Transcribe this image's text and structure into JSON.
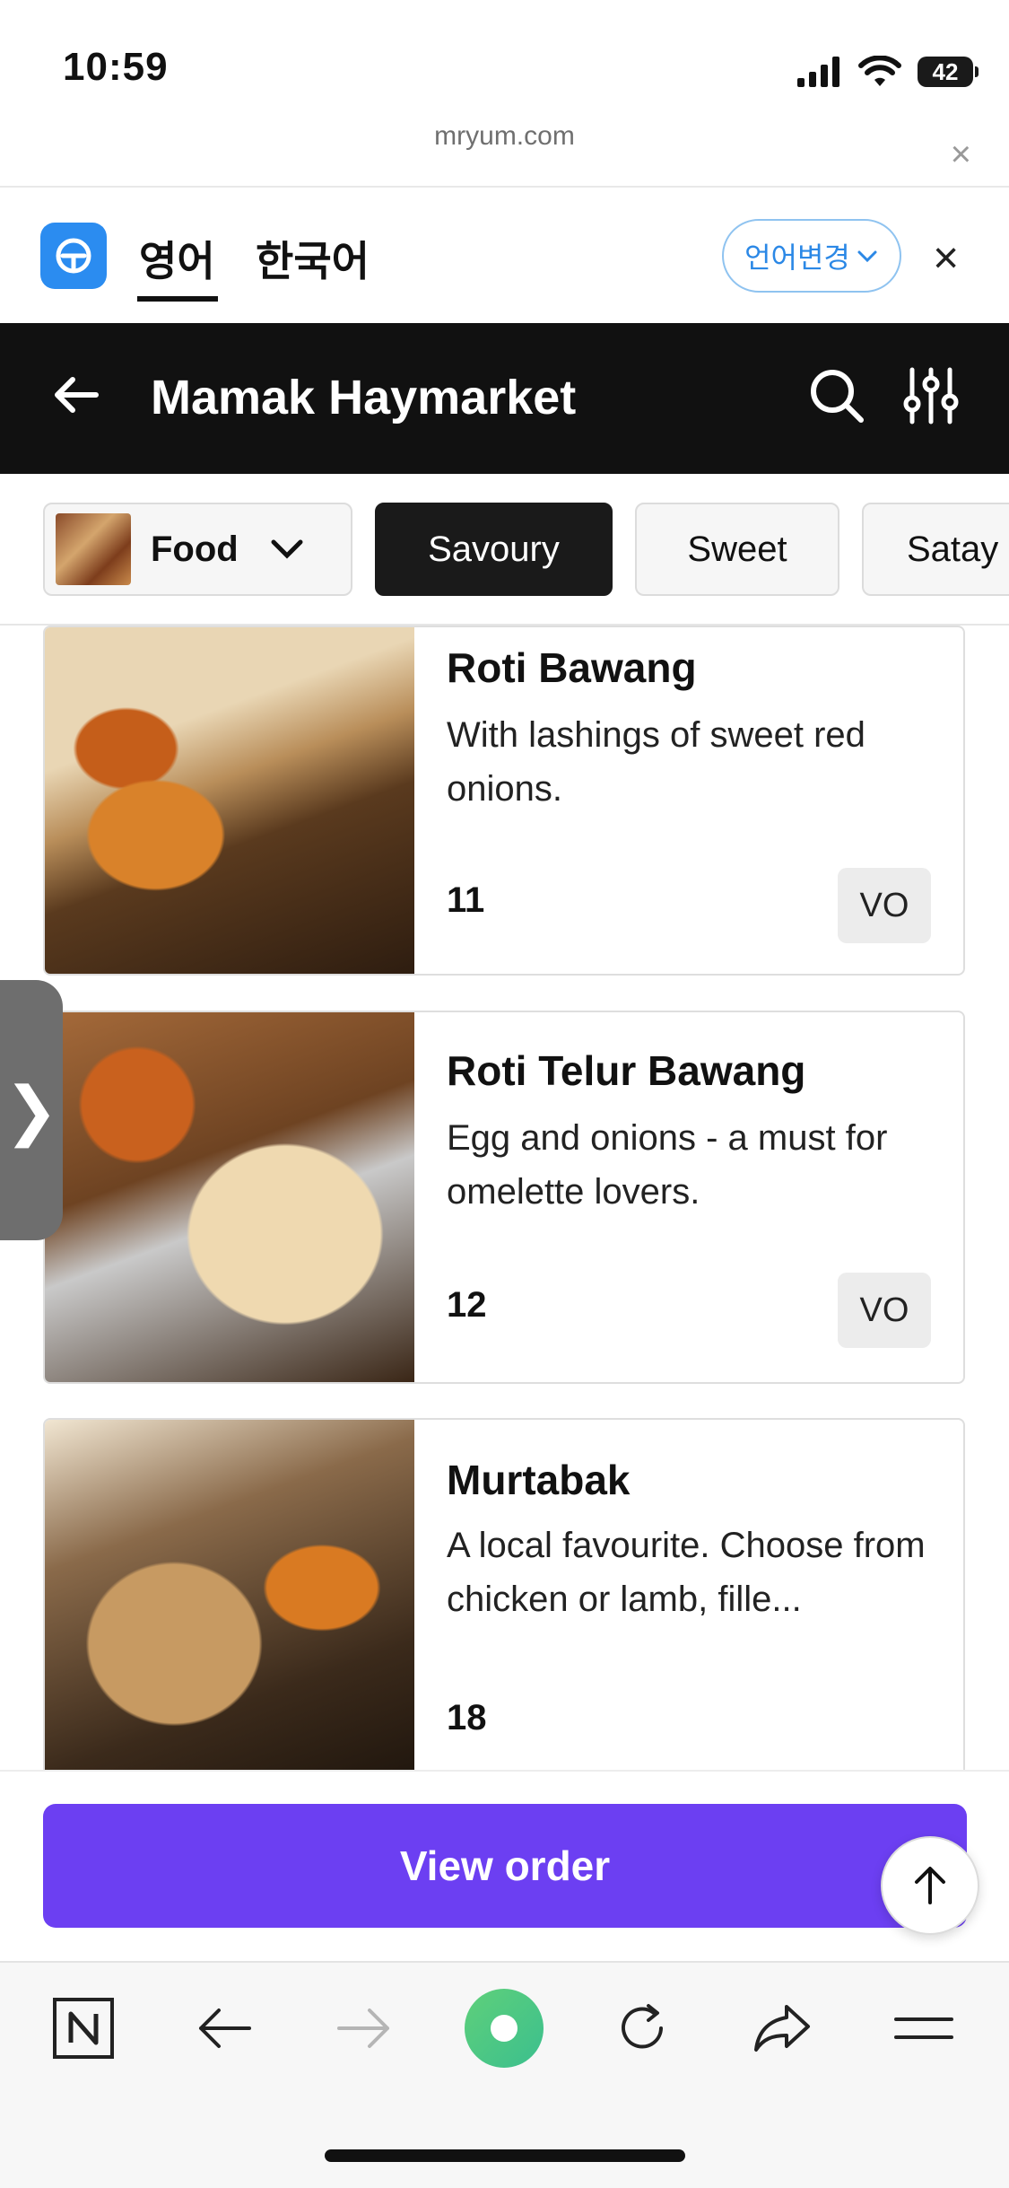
{
  "status_bar": {
    "time": "10:59",
    "battery": "42"
  },
  "browser": {
    "url": "mryum.com",
    "close_label": "×"
  },
  "translate_bar": {
    "tab_source": "영어",
    "tab_target": "한국어",
    "change_language": "언어변경",
    "close_label": "×"
  },
  "header": {
    "title": "Mamak Haymarket"
  },
  "categories": {
    "selector_label": "Food",
    "chips": [
      "Savoury",
      "Sweet",
      "Satay"
    ]
  },
  "menu_items": [
    {
      "name": "Roti Bawang",
      "description": "With lashings of sweet red onions.",
      "price": "11",
      "badge": "VO"
    },
    {
      "name": "Roti Telur Bawang",
      "description": "Egg and onions - a must for omelette lovers.",
      "price": "12",
      "badge": "VO"
    },
    {
      "name": "Murtabak",
      "description": "A local favourite. Choose from chicken or lamb, fille...",
      "price": "18"
    }
  ],
  "side_tab": {
    "label": "❯"
  },
  "order": {
    "view_order_label": "View order"
  },
  "colors": {
    "accent": "#6c3ff2",
    "header_bg": "#111111",
    "selected_chip": "#1a1a1a",
    "translate_blue": "#2b88e6"
  }
}
